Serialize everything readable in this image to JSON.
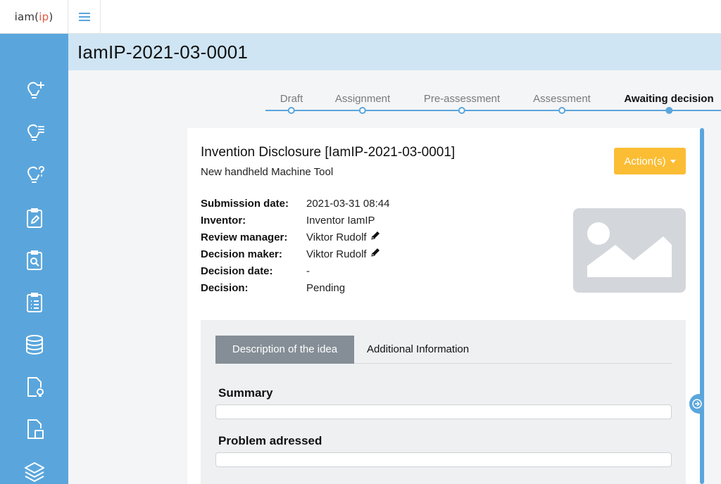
{
  "app": {
    "logo_text_a": "iam",
    "logo_text_b": "ip"
  },
  "title": "IamIP-2021-03-0001",
  "stepper": {
    "steps": [
      {
        "label": "Draft"
      },
      {
        "label": "Assignment"
      },
      {
        "label": "Pre-assessment"
      },
      {
        "label": "Assessment"
      },
      {
        "label": "Awaiting decision"
      }
    ],
    "active_index": 4
  },
  "card": {
    "title": "Invention Disclosure [IamIP-2021-03-0001]",
    "subtitle": "New handheld Machine Tool",
    "action_label": "Action(s)",
    "meta": [
      {
        "key": "Submission date:",
        "value": "2021-03-31 08:44"
      },
      {
        "key": "Inventor:",
        "value": "Inventor IamIP"
      },
      {
        "key": "Review manager:",
        "value": "Viktor Rudolf",
        "editable": true
      },
      {
        "key": "Decision maker:",
        "value": "Viktor Rudolf",
        "editable": true
      },
      {
        "key": "Decision date:",
        "value": "-"
      },
      {
        "key": "Decision:",
        "value": "Pending"
      }
    ]
  },
  "tabs": [
    {
      "label": "Description of the idea",
      "active": true
    },
    {
      "label": "Additional Information",
      "active": false
    }
  ],
  "sections": {
    "summary": "Summary",
    "problem": "Problem adressed"
  },
  "icons": {
    "sidebar": [
      "lightbulb-plus-icon",
      "lightbulb-list-icon",
      "lightbulb-question-icon",
      "clipboard-edit-icon",
      "clipboard-search-icon",
      "clipboard-list-icon",
      "database-icon",
      "document-lightbulb-icon",
      "document-copy-icon",
      "layers-icon"
    ],
    "hamburger": "hamburger-menu-icon",
    "edit": "pencil-icon",
    "panel_toggle": "arrow-right-icon",
    "placeholder": "image-placeholder-icon"
  },
  "colors": {
    "sidebar": "#5aa6dc",
    "title_bar": "#cfe5f3",
    "accent": "#5aa6dc",
    "action": "#fbbd34",
    "tab_active": "#858e96"
  }
}
